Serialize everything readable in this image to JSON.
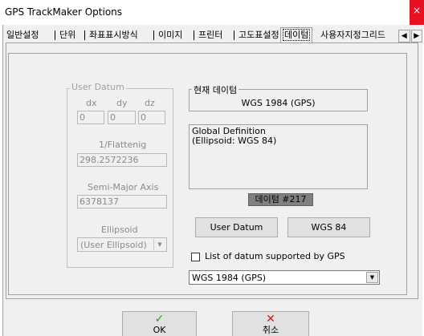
{
  "window": {
    "title": "GPS TrackMaker Options",
    "close_glyph": "×"
  },
  "tabs": [
    {
      "label": "일반설정"
    },
    {
      "label": "단위"
    },
    {
      "label": "좌표표시방식"
    },
    {
      "label": "이미지"
    },
    {
      "label": "프린터"
    },
    {
      "label": "고도표설정"
    },
    {
      "label": "데이텀"
    },
    {
      "label": "사용자지정그리드"
    }
  ],
  "tab_scroll": {
    "left": "◀",
    "right": "▶"
  },
  "user_datum": {
    "title": "User Datum",
    "dx_label": "dx",
    "dy_label": "dy",
    "dz_label": "dz",
    "dx_value": "0",
    "dy_value": "0",
    "dz_value": "0",
    "flattening_label": "1/Flattenig",
    "flattening_value": "298.2572236",
    "semimajor_label": "Semi-Major Axis",
    "semimajor_value": "6378137",
    "ellipsoid_label": "Ellipsoid",
    "ellipsoid_value": "(User Ellipsoid)"
  },
  "current_datum": {
    "title": "현재 데이텀",
    "value": "WGS 1984 (GPS)",
    "description_line1": "Global Definition",
    "description_line2": "(Ellipsoid: WGS 84)",
    "badge": "데이텀 #217"
  },
  "buttons": {
    "user_datum": "User Datum",
    "wgs84": "WGS 84"
  },
  "gps_checkbox": {
    "label": "List of datum supported by GPS",
    "checked": false
  },
  "datum_select": {
    "value": "WGS 1984 (GPS)"
  },
  "footer": {
    "ok_label": "OK",
    "ok_icon": "✓",
    "cancel_label": "취소",
    "cancel_icon": "✕"
  },
  "colors": {
    "ok_icon": "#2a9a2a",
    "cancel_icon": "#d81414",
    "close_button": "#e81123"
  }
}
